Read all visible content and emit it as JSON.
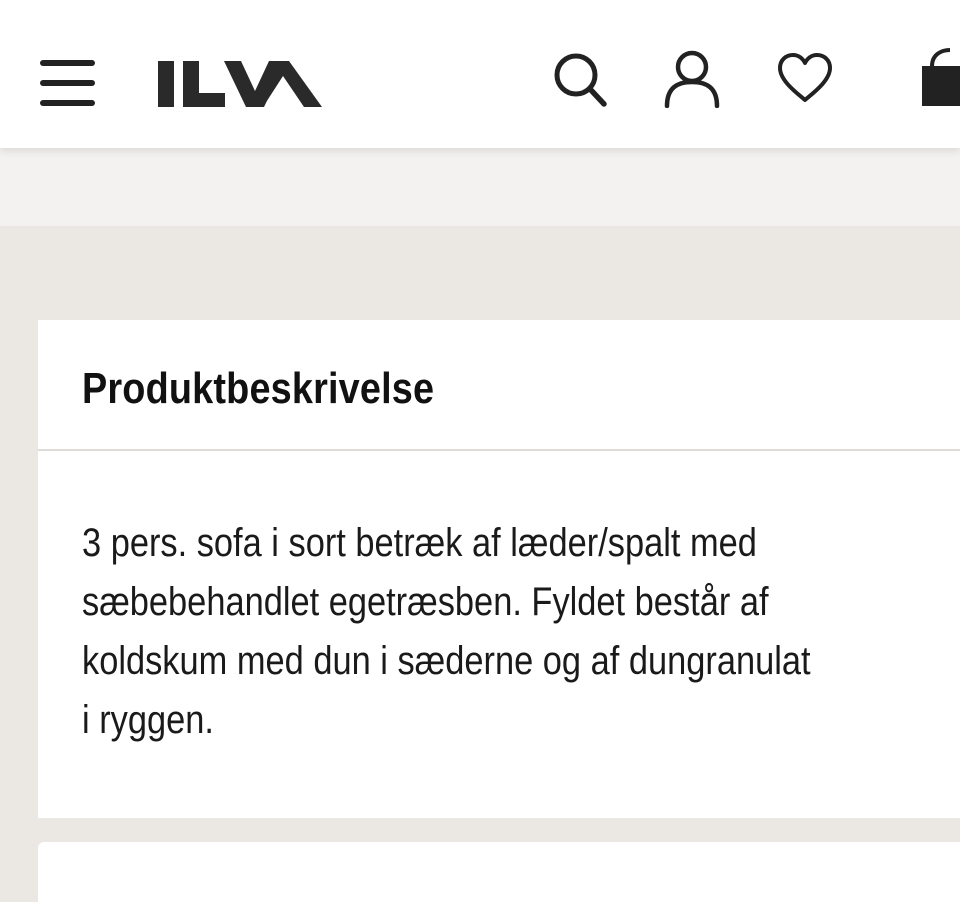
{
  "header": {
    "brand": "ILVA",
    "icons": [
      "menu-icon",
      "search-icon",
      "user-icon",
      "heart-icon",
      "shopping-bag-icon"
    ]
  },
  "product_description": {
    "title": "Produktbeskrivelse",
    "lines": [
      "3 pers. sofa i sort betræk af læder/spalt med",
      "sæbebehandlet egetræsben. Fyldet består af",
      "koldskum med dun i sæderne og af dungranulat",
      "i ryggen."
    ]
  },
  "colors": {
    "header_bg": "#ffffff",
    "page_bg": "#ebe7e2",
    "strip_bg": "#f4f2f0",
    "text": "#111111"
  }
}
